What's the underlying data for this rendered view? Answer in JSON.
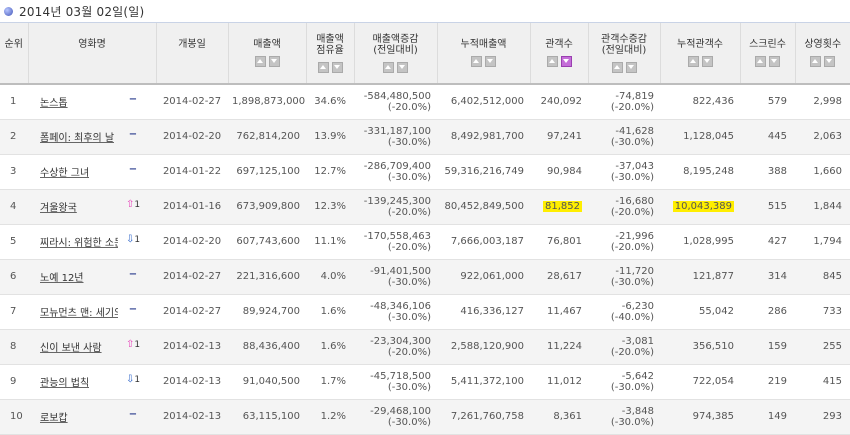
{
  "title_date": "2014년 03월 02일(일)",
  "headers": {
    "rank": "순위",
    "title": "영화명",
    "open_date": "개봉일",
    "sales": "매출액",
    "share": "매출액\n점유율",
    "sales_change": "매출액증감\n(전일대비)",
    "cum_sales": "누적매출액",
    "audience": "관객수",
    "aud_change": "관객수증감\n(전일대비)",
    "cum_audience": "누적관객수",
    "screens": "스크린수",
    "shows": "상영횟수"
  },
  "rows": [
    {
      "rank": "1",
      "title": "논스톱",
      "change_type": "same",
      "change_mark": "−",
      "change_num": "",
      "open": "2014-02-27",
      "sales": "1,898,873,000",
      "share": "34.6%",
      "sales_diff": "-584,480,500",
      "sales_pct": "(-20.0%)",
      "cum_sales": "6,402,512,000",
      "aud": "240,092",
      "aud_diff": "-74,819",
      "aud_pct": "(-20.0%)",
      "cum_aud": "822,436",
      "screens": "579",
      "shows": "2,998",
      "hl_aud": false,
      "hl_cum": false
    },
    {
      "rank": "2",
      "title": "폼페이: 최후의 날",
      "change_type": "same",
      "change_mark": "−",
      "change_num": "",
      "open": "2014-02-20",
      "sales": "762,814,200",
      "share": "13.9%",
      "sales_diff": "-331,187,100",
      "sales_pct": "(-30.0%)",
      "cum_sales": "8,492,981,700",
      "aud": "97,241",
      "aud_diff": "-41,628",
      "aud_pct": "(-30.0%)",
      "cum_aud": "1,128,045",
      "screens": "445",
      "shows": "2,063",
      "hl_aud": false,
      "hl_cum": false
    },
    {
      "rank": "3",
      "title": "수상한 그녀",
      "change_type": "same",
      "change_mark": "−",
      "change_num": "",
      "open": "2014-01-22",
      "sales": "697,125,100",
      "share": "12.7%",
      "sales_diff": "-286,709,400",
      "sales_pct": "(-30.0%)",
      "cum_sales": "59,316,216,749",
      "aud": "90,984",
      "aud_diff": "-37,043",
      "aud_pct": "(-30.0%)",
      "cum_aud": "8,195,248",
      "screens": "388",
      "shows": "1,660",
      "hl_aud": false,
      "hl_cum": false
    },
    {
      "rank": "4",
      "title": "겨울왕국",
      "change_type": "up",
      "change_mark": "⇧",
      "change_num": "1",
      "open": "2014-01-16",
      "sales": "673,909,800",
      "share": "12.3%",
      "sales_diff": "-139,245,300",
      "sales_pct": "(-20.0%)",
      "cum_sales": "80,452,849,500",
      "aud": "81,852",
      "aud_diff": "-16,680",
      "aud_pct": "(-20.0%)",
      "cum_aud": "10,043,389",
      "screens": "515",
      "shows": "1,844",
      "hl_aud": true,
      "hl_cum": true
    },
    {
      "rank": "5",
      "title": "찌라시: 위험한 소문",
      "change_type": "down",
      "change_mark": "⇩",
      "change_num": "1",
      "open": "2014-02-20",
      "sales": "607,743,600",
      "share": "11.1%",
      "sales_diff": "-170,558,463",
      "sales_pct": "(-20.0%)",
      "cum_sales": "7,666,003,187",
      "aud": "76,801",
      "aud_diff": "-21,996",
      "aud_pct": "(-20.0%)",
      "cum_aud": "1,028,995",
      "screens": "427",
      "shows": "1,794",
      "hl_aud": false,
      "hl_cum": false
    },
    {
      "rank": "6",
      "title": "노예 12년",
      "change_type": "same",
      "change_mark": "−",
      "change_num": "",
      "open": "2014-02-27",
      "sales": "221,316,600",
      "share": "4.0%",
      "sales_diff": "-91,401,500",
      "sales_pct": "(-30.0%)",
      "cum_sales": "922,061,000",
      "aud": "28,617",
      "aud_diff": "-11,720",
      "aud_pct": "(-30.0%)",
      "cum_aud": "121,877",
      "screens": "314",
      "shows": "845",
      "hl_aud": false,
      "hl_cum": false
    },
    {
      "rank": "7",
      "title": "모뉴먼츠 맨: 세기의 작전",
      "change_type": "same",
      "change_mark": "−",
      "change_num": "",
      "open": "2014-02-27",
      "sales": "89,924,700",
      "share": "1.6%",
      "sales_diff": "-48,346,106",
      "sales_pct": "(-30.0%)",
      "cum_sales": "416,336,127",
      "aud": "11,467",
      "aud_diff": "-6,230",
      "aud_pct": "(-40.0%)",
      "cum_aud": "55,042",
      "screens": "286",
      "shows": "733",
      "hl_aud": false,
      "hl_cum": false
    },
    {
      "rank": "8",
      "title": "신이 보낸 사람",
      "change_type": "up",
      "change_mark": "⇧",
      "change_num": "1",
      "open": "2014-02-13",
      "sales": "88,436,400",
      "share": "1.6%",
      "sales_diff": "-23,304,300",
      "sales_pct": "(-20.0%)",
      "cum_sales": "2,588,120,900",
      "aud": "11,224",
      "aud_diff": "-3,081",
      "aud_pct": "(-20.0%)",
      "cum_aud": "356,510",
      "screens": "159",
      "shows": "255",
      "hl_aud": false,
      "hl_cum": false
    },
    {
      "rank": "9",
      "title": "관능의 법칙",
      "change_type": "down",
      "change_mark": "⇩",
      "change_num": "1",
      "open": "2014-02-13",
      "sales": "91,040,500",
      "share": "1.7%",
      "sales_diff": "-45,718,500",
      "sales_pct": "(-30.0%)",
      "cum_sales": "5,411,372,100",
      "aud": "11,012",
      "aud_diff": "-5,642",
      "aud_pct": "(-30.0%)",
      "cum_aud": "722,054",
      "screens": "219",
      "shows": "415",
      "hl_aud": false,
      "hl_cum": false
    },
    {
      "rank": "10",
      "title": "로보캅",
      "change_type": "same",
      "change_mark": "−",
      "change_num": "",
      "open": "2014-02-13",
      "sales": "63,115,100",
      "share": "1.2%",
      "sales_diff": "-29,468,100",
      "sales_pct": "(-30.0%)",
      "cum_sales": "7,261,760,758",
      "aud": "8,361",
      "aud_diff": "-3,848",
      "aud_pct": "(-30.0%)",
      "cum_aud": "974,385",
      "screens": "149",
      "shows": "293",
      "hl_aud": false,
      "hl_cum": false
    }
  ],
  "colors": {
    "highlight": "#ffee00",
    "header_bg": "#f0f0f0",
    "up": "#e63db8",
    "down": "#2e64c8",
    "same": "#2e3f8f"
  }
}
